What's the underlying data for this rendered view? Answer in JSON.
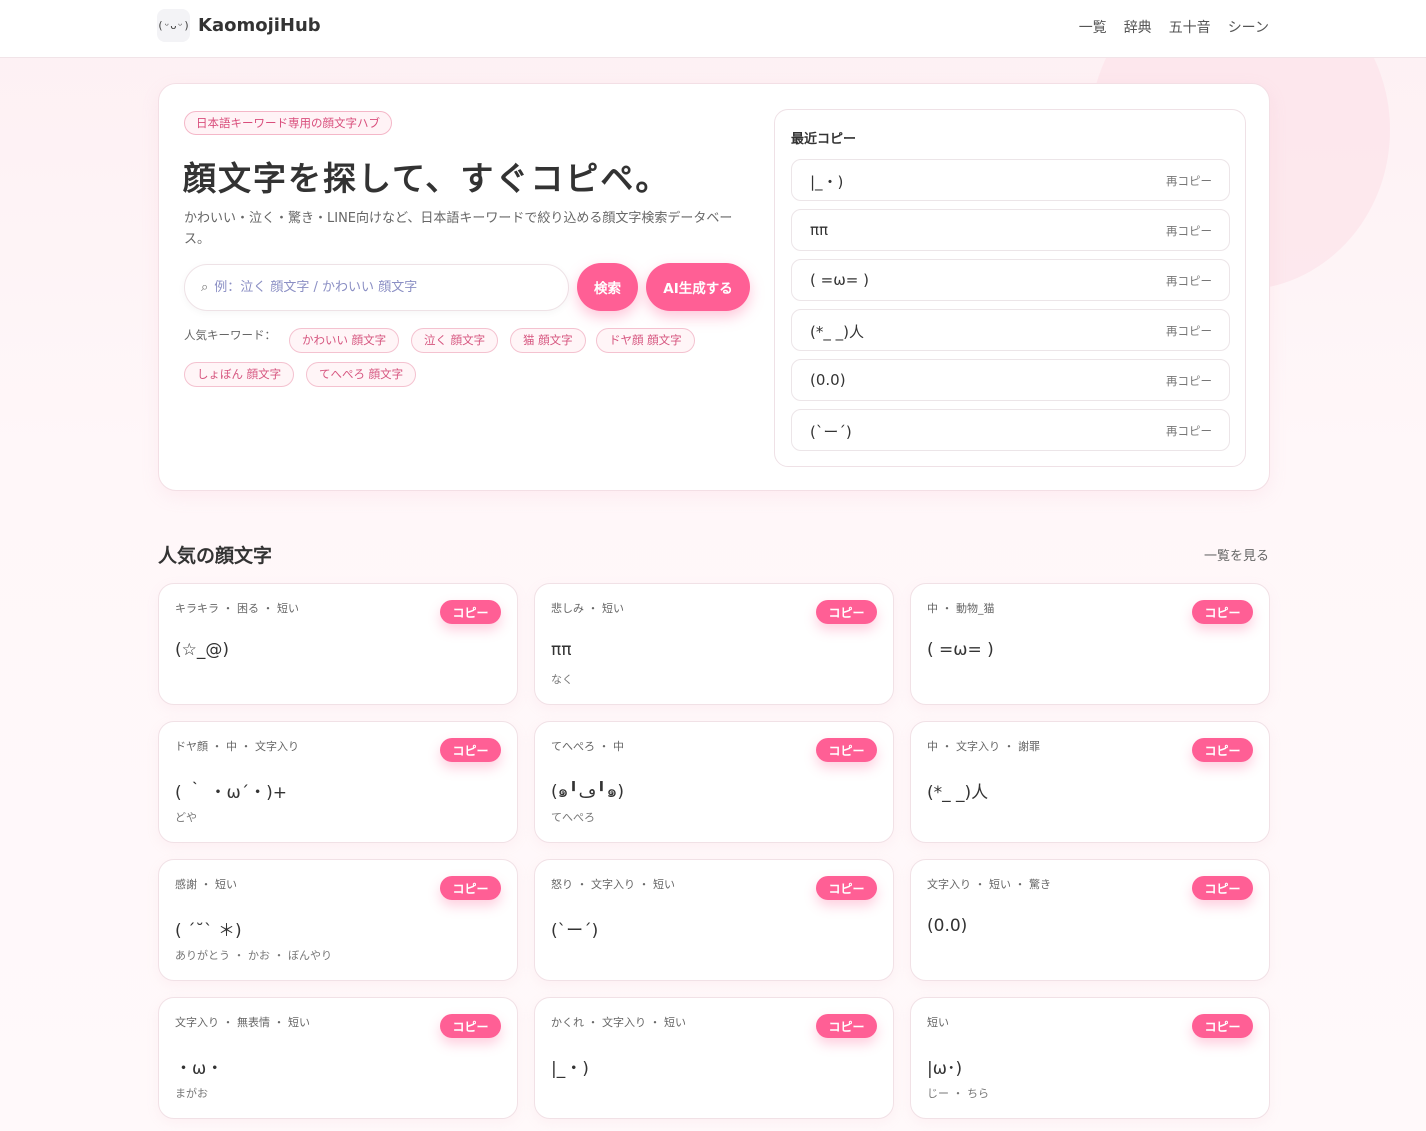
{
  "header": {
    "logo_icon": "(ᵕᴗᵕ)",
    "logo_text": "KaomojiHub",
    "nav": [
      "一覧",
      "辞典",
      "五十音",
      "シーン"
    ]
  },
  "hero": {
    "tag": "日本語キーワード専用の顔文字ハブ",
    "title": "顔文字を探して、すぐコピペ。",
    "description": "かわいい・泣く・驚き・LINE向けなど、日本語キーワードで絞り込める顔文字検索データベース。",
    "search_icon": "⌕",
    "search_placeholder": "例：泣く 顔文字 / かわいい 顔文字",
    "search_button": "検索",
    "ai_button": "AI生成する",
    "popular_label": "人気キーワード：",
    "popular_keywords": [
      "かわいい 顔文字",
      "泣く 顔文字",
      "猫 顔文字",
      "ドヤ顔 顔文字",
      "しょぼん 顔文字",
      "てへぺろ 顔文字"
    ]
  },
  "recent": {
    "title": "最近コピー",
    "recopy_label": "再コピー",
    "items": [
      "|_・)",
      "ππ",
      "( =ω= )",
      "(*_ _)人",
      "(0.0)",
      "(`ー´)"
    ]
  },
  "popular": {
    "title": "人気の顔文字",
    "see_all": "一覧を見る",
    "copy_label": "コピー",
    "cards": [
      {
        "tags": "キラキラ ・ 困る ・ 短い",
        "kaomoji": "(☆_@)",
        "reading": ""
      },
      {
        "tags": "悲しみ ・ 短い",
        "kaomoji": "ππ",
        "reading": "なく"
      },
      {
        "tags": "中 ・ 動物_猫",
        "kaomoji": "( =ω= )",
        "reading": ""
      },
      {
        "tags": "ドヤ顔 ・ 中 ・ 文字入り",
        "kaomoji": "( ｀ ・ω´・)+",
        "reading": "どや"
      },
      {
        "tags": "てへぺろ ・ 中",
        "kaomoji": "(๑╹ڡ╹๑)",
        "reading": "てへぺろ"
      },
      {
        "tags": "中 ・ 文字入り ・ 謝罪",
        "kaomoji": "(*_ _)人",
        "reading": ""
      },
      {
        "tags": "感謝 ・ 短い",
        "kaomoji": "( ´˘` ＊)",
        "reading": "ありがとう ・ かお ・ ぼんやり"
      },
      {
        "tags": "怒り ・ 文字入り ・ 短い",
        "kaomoji": "(`ー´)",
        "reading": ""
      },
      {
        "tags": "文字入り ・ 短い ・ 驚き",
        "kaomoji": "(0.0)",
        "reading": ""
      },
      {
        "tags": "文字入り ・ 無表情 ・ 短い",
        "kaomoji": "・ω・",
        "reading": "まがお"
      },
      {
        "tags": "かくれ ・ 文字入り ・ 短い",
        "kaomoji": "|_・)",
        "reading": ""
      },
      {
        "tags": "短い",
        "kaomoji": "|ω･)",
        "reading": "じー ・ ちら"
      }
    ]
  }
}
